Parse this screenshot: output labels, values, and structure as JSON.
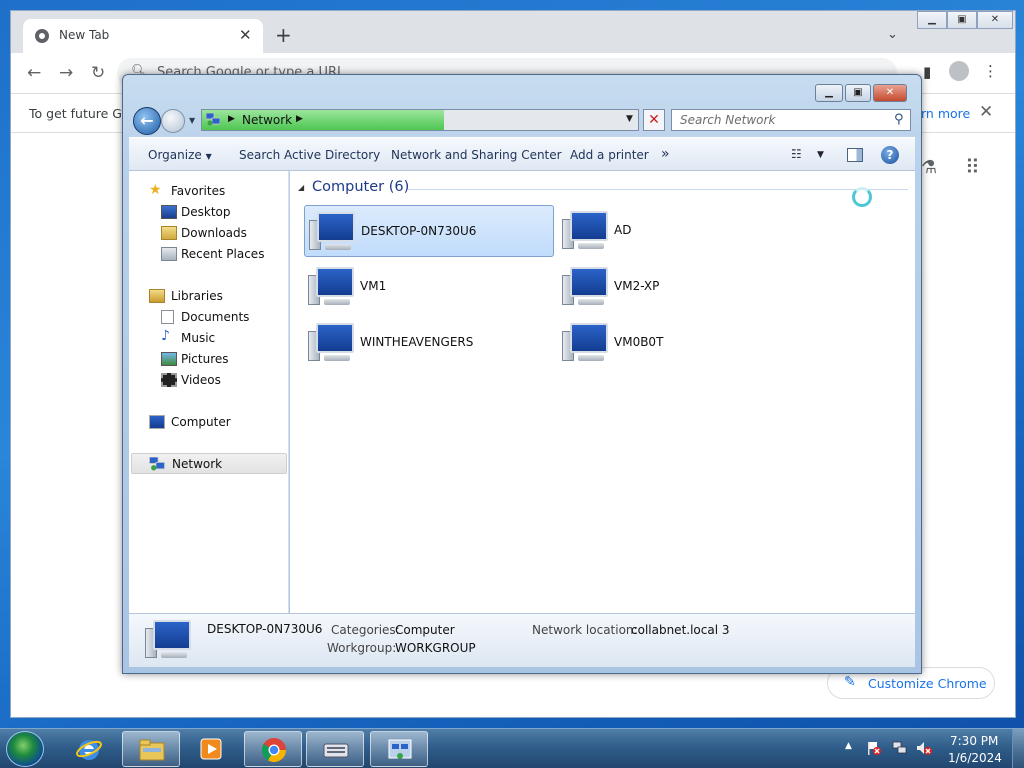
{
  "chrome": {
    "tab_title": "New Tab",
    "tab_close": "✕",
    "new_tab": "+",
    "tab_search": "⌄",
    "omnibox_placeholder": "Search Google or type a URL",
    "infobar_text": "To get future Go",
    "infobar_link": "rn more",
    "infobar_close": "✕",
    "customize_label": "Customize Chrome",
    "nav": {
      "back": "←",
      "forward": "→",
      "reload": "↻"
    }
  },
  "explorer": {
    "address": {
      "location": "Network"
    },
    "search_placeholder": "Search Network",
    "command_bar": {
      "organize": "Organize",
      "search_ad": "Search Active Directory",
      "network_sharing": "Network and Sharing Center",
      "add_printer": "Add a printer",
      "more": "»"
    },
    "nav_pane": {
      "favorites": "Favorites",
      "desktop": "Desktop",
      "downloads": "Downloads",
      "recent_places": "Recent Places",
      "libraries": "Libraries",
      "documents": "Documents",
      "music": "Music",
      "pictures": "Pictures",
      "videos": "Videos",
      "computer": "Computer",
      "network": "Network"
    },
    "group_label": "Computer (6)",
    "computers": [
      {
        "name": "DESKTOP-0N730U6"
      },
      {
        "name": "AD"
      },
      {
        "name": "VM1"
      },
      {
        "name": "VM2-XP"
      },
      {
        "name": "WINTHEAVENGERS"
      },
      {
        "name": "VM0B0T"
      }
    ],
    "details": {
      "name": "DESKTOP-0N730U6",
      "categories_label": "Categories:",
      "categories_value": "Computer",
      "workgroup_label": "Workgroup:",
      "workgroup_value": "WORKGROUP",
      "location_label": "Network location:",
      "location_value": "collabnet.local  3"
    }
  },
  "taskbar": {
    "time": "7:30 PM",
    "date": "1/6/2024"
  },
  "colors": {
    "accent": "#1a73e8",
    "explorer_link": "#1e3a8a",
    "selection": "#c1dcfc"
  }
}
